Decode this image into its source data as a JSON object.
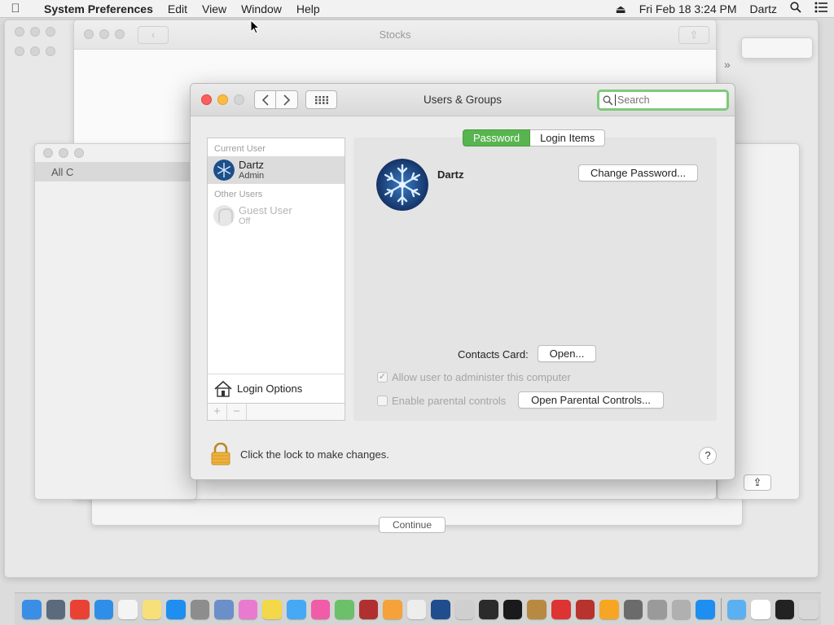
{
  "menubar": {
    "app_name": "System Preferences",
    "items": [
      "Edit",
      "View",
      "Window",
      "Help"
    ],
    "clock": "Fri Feb 18  3:24 PM",
    "user": "Dartz"
  },
  "background": {
    "stocks_title": "Stocks",
    "left_window_label": "All C",
    "continue_label": "Continue"
  },
  "dialog": {
    "title": "Users & Groups",
    "search_placeholder": "Search",
    "user_list": {
      "current_header": "Current User",
      "current_user": {
        "name": "Dartz",
        "role": "Admin"
      },
      "other_header": "Other Users",
      "guest_user": {
        "name": "Guest User",
        "status": "Off"
      },
      "login_options": "Login Options",
      "add_label": "+",
      "remove_label": "−"
    },
    "tabs": [
      "Password",
      "Login Items"
    ],
    "account_name": "Dartz",
    "change_password": "Change Password...",
    "contacts_label": "Contacts Card:",
    "open_label": "Open...",
    "allow_admin": "Allow user to administer this computer",
    "allow_admin_checked": true,
    "parental_controls": "Enable parental controls",
    "parental_checked": false,
    "open_parental": "Open Parental Controls...",
    "lock_text": "Click the lock to make changes.",
    "help_label": "?"
  },
  "colors": {
    "accent_green": "#58b44f",
    "search_focus": "#7fc97a",
    "close": "#fc605c",
    "minimize": "#fdbc40"
  },
  "dock": {
    "icons": [
      "finder-icon",
      "launchpad-icon",
      "chrome-icon",
      "safari-icon",
      "calendar-icon",
      "notes-icon",
      "app-store-icon",
      "system-preferences-icon",
      "preview-icon",
      "photos-icon",
      "stickies-icon",
      "messages-icon",
      "itunes-icon",
      "maps-icon",
      "photo-booth-icon",
      "photos-color-icon",
      "textedit-icon",
      "quicktime-icon",
      "script-editor-icon",
      "grapher-icon",
      "stocks-icon",
      "book-icon",
      "flashcard-icon",
      "dictionary-icon",
      "home-icon",
      "font-book-icon",
      "disk-utility-icon",
      "automator-icon",
      "app-store-2-icon",
      "downloads-folder-icon",
      "window-icon",
      "terminal-icon",
      "trash-icon"
    ]
  }
}
